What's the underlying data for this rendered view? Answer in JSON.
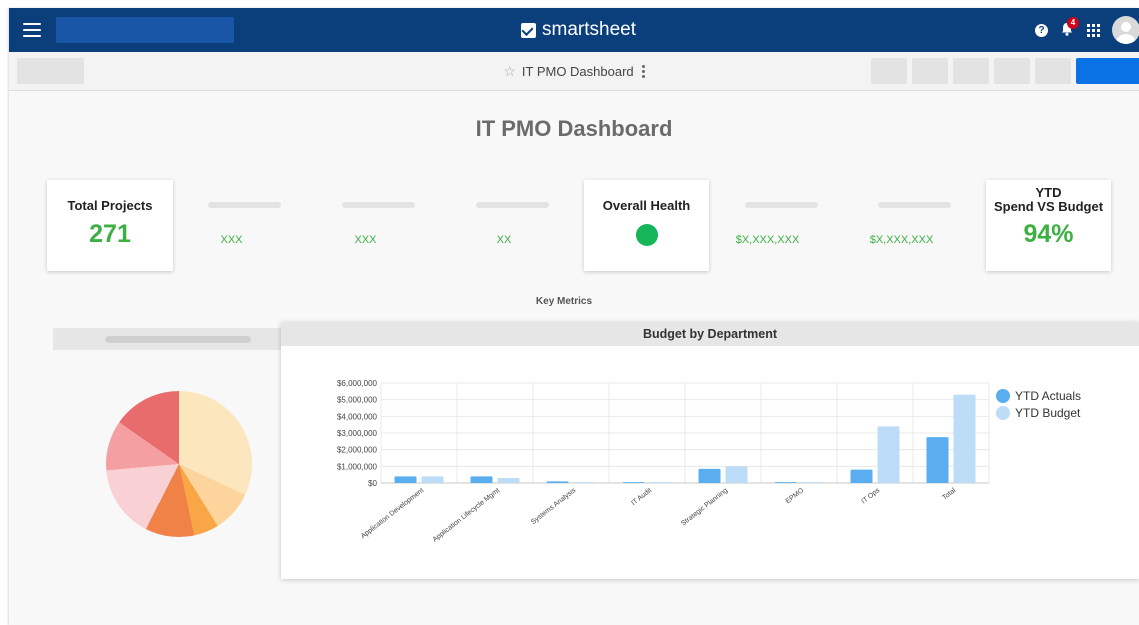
{
  "app": {
    "brand": "smartsheet",
    "notification_count": "4"
  },
  "toolbar": {
    "sheet_title": "IT PMO Dashboard"
  },
  "dashboard": {
    "title": "IT PMO Dashboard",
    "total_projects": {
      "label": "Total Projects",
      "value": "271"
    },
    "placeholder_metrics": [
      "XXX",
      "XXX",
      "XX",
      "$X,XXX,XXX",
      "$X,XXX,XXX"
    ],
    "overall_health": {
      "label": "Overall Health",
      "status_color": "#16b55a"
    },
    "ytd_spend": {
      "label_line1": "YTD",
      "label_line2": "Spend VS Budget",
      "value": "94%"
    },
    "key_metrics_label": "Key Metrics"
  },
  "pie_chart": {
    "colors": [
      "#fce6bd",
      "#fcd49c",
      "#f9a646",
      "#f08247",
      "#f9d0d3",
      "#f4a0a3",
      "#e86c6c"
    ]
  },
  "chart_data": {
    "type": "bar",
    "title": "Budget by Department",
    "categories": [
      "Application Development",
      "Application Lifecycle Mgmt",
      "Systems Analysis",
      "IT Audit",
      "Strategic Planning",
      "EPMO",
      "IT Ops",
      "Total"
    ],
    "series": [
      {
        "name": "YTD Actuals",
        "color": "#5aaeef",
        "values": [
          400000,
          400000,
          100000,
          50000,
          850000,
          50000,
          800000,
          2750000
        ]
      },
      {
        "name": "YTD Budget",
        "color": "#bddcf8",
        "values": [
          400000,
          300000,
          50000,
          50000,
          1000000,
          50000,
          3400000,
          5300000
        ]
      }
    ],
    "yticks": [
      "$0",
      "$1,000,000",
      "$2,000,000",
      "$3,000,000",
      "$4,000,000",
      "$5,000,000",
      "$6,000,000"
    ],
    "ylim": [
      0,
      6000000
    ],
    "legend_position": "right",
    "grid": true
  }
}
